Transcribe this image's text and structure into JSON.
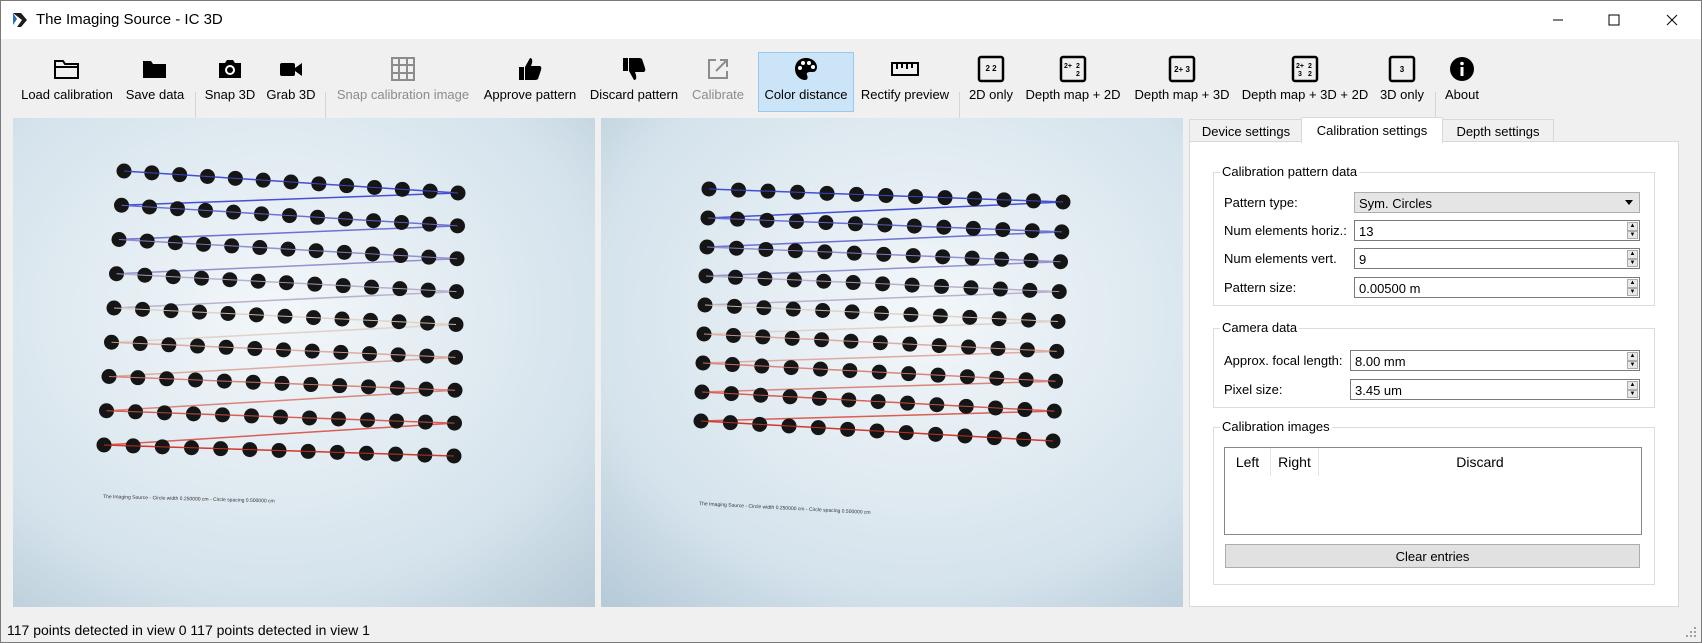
{
  "window": {
    "title": "The Imaging Source - IC 3D"
  },
  "toolbar": {
    "load_calibration": "Load calibration",
    "save_data": "Save data",
    "snap_3d": "Snap 3D",
    "grab_3d": "Grab 3D",
    "snap_calibration_image": "Snap calibration image",
    "approve_pattern": "Approve pattern",
    "discard_pattern": "Discard pattern",
    "calibrate": "Calibrate",
    "color_distance": "Color distance",
    "rectify_preview": "Rectify preview",
    "only_2d": "2D only",
    "depth_map_2d": "Depth map + 2D",
    "depth_map_3d": "Depth map + 3D",
    "depth_map_3d_2d": "Depth map + 3D + 2D",
    "only_3d": "3D only",
    "about": "About"
  },
  "views": {
    "left_caption": "The Imaging Source - Circle width 0.250000 cm - Circle spacing 0.500000 cm",
    "right_caption": "The Imaging Source - Circle width 0.250000 cm - Circle spacing 0.500000 cm"
  },
  "tabs": {
    "device_settings": "Device settings",
    "calibration_settings": "Calibration settings",
    "depth_settings": "Depth settings"
  },
  "calibration": {
    "pattern_group_title": "Calibration pattern data",
    "pattern_type_label": "Pattern type:",
    "pattern_type_value": "Sym. Circles",
    "horiz_label": "Num elements horiz.:",
    "horiz_value": "13",
    "vert_label": "Num elements vert.",
    "vert_value": "9",
    "size_label": "Pattern size:",
    "size_value": "0.00500 m",
    "camera_group_title": "Camera data",
    "focal_label": "Approx. focal length:",
    "focal_value": "8.00 mm",
    "pixel_label": "Pixel size:",
    "pixel_value": "3.45 um",
    "images_group_title": "Calibration images",
    "col_left": "Left",
    "col_right": "Right",
    "col_discard": "Discard",
    "clear_entries": "Clear entries"
  },
  "status": {
    "text": "117 points detected in view 0 117 points detected in view 1"
  },
  "colors": {
    "accent_active": "#cce4f7",
    "line_blue": "#4a5ad8",
    "line_red": "#d83a2a"
  }
}
